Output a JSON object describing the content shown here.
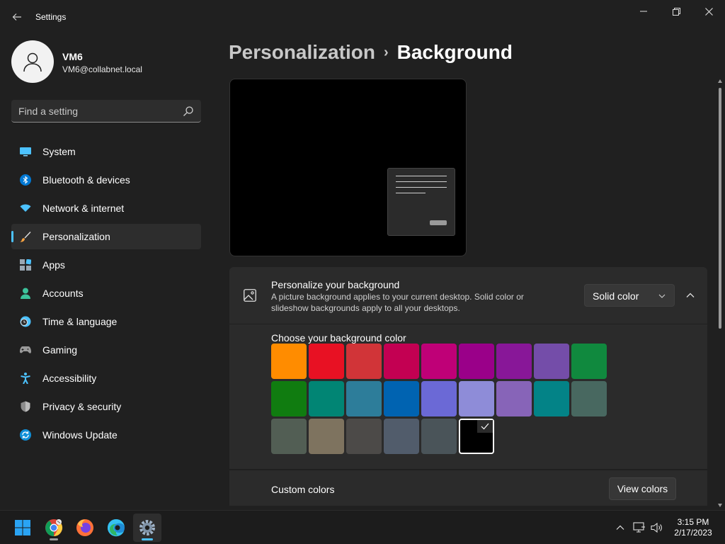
{
  "window": {
    "app_title": "Settings",
    "controls": [
      "minimize",
      "restore",
      "close"
    ]
  },
  "profile": {
    "name": "VM6",
    "email": "VM6@collabnet.local"
  },
  "search": {
    "placeholder": "Find a setting"
  },
  "sidebar": {
    "items": [
      {
        "label": "System",
        "icon": "system-icon",
        "active": false
      },
      {
        "label": "Bluetooth & devices",
        "icon": "bluetooth-icon",
        "active": false
      },
      {
        "label": "Network & internet",
        "icon": "wifi-icon",
        "active": false
      },
      {
        "label": "Personalization",
        "icon": "paintbrush-icon",
        "active": true
      },
      {
        "label": "Apps",
        "icon": "apps-icon",
        "active": false
      },
      {
        "label": "Accounts",
        "icon": "person-icon",
        "active": false
      },
      {
        "label": "Time & language",
        "icon": "globe-clock-icon",
        "active": false
      },
      {
        "label": "Gaming",
        "icon": "gamepad-icon",
        "active": false
      },
      {
        "label": "Accessibility",
        "icon": "accessibility-icon",
        "active": false
      },
      {
        "label": "Privacy & security",
        "icon": "shield-icon",
        "active": false
      },
      {
        "label": "Windows Update",
        "icon": "update-icon",
        "active": false
      }
    ]
  },
  "breadcrumb": {
    "parent": "Personalization",
    "separator": "›",
    "current": "Background"
  },
  "background_card": {
    "title": "Personalize your background",
    "description": "A picture background applies to your current desktop. Solid color or slideshow backgrounds apply to all your desktops.",
    "dropdown_value": "Solid color",
    "expanded": true
  },
  "colors": {
    "label": "Choose your background color",
    "swatches": [
      [
        "#ff8c00",
        "#e81123",
        "#d13438",
        "#c30052",
        "#bf0077",
        "#9a0089",
        "#881798",
        "#744da9",
        "#10893e"
      ],
      [
        "#107c10",
        "#018574",
        "#2d7d9a",
        "#0063b1",
        "#6b69d6",
        "#8e8cd8",
        "#8764b8",
        "#038387",
        "#486860"
      ],
      [
        "#525e54",
        "#7e735f",
        "#4c4a48",
        "#515c6b",
        "#4a5459",
        "#000000"
      ]
    ],
    "selected": "#000000",
    "accent": "#4cc2ff"
  },
  "custom_colors": {
    "label": "Custom colors",
    "button": "View colors"
  },
  "taskbar": {
    "apps": [
      "windows-start-icon",
      "chrome-icon",
      "firefox-icon",
      "edge-icon",
      "settings-gear-icon"
    ],
    "active_app": "settings-gear-icon",
    "tray": [
      "chevron-up-icon",
      "network-icon",
      "volume-icon"
    ],
    "time": "3:15 PM",
    "date": "2/17/2023"
  }
}
